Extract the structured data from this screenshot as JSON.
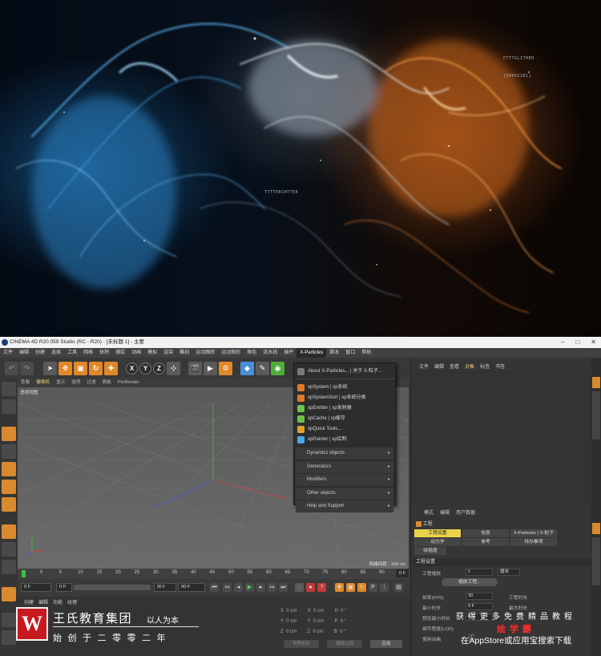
{
  "window": {
    "title": "CINEMA 4D R20.059 Studio (RC - R20) - [未标题 1] - 主要",
    "minimize": "–",
    "maximize": "□",
    "close": "✕"
  },
  "menubar": [
    "文件",
    "编辑",
    "创建",
    "选择",
    "工具",
    "网格",
    "体积",
    "捕捉",
    "动画",
    "模拟",
    "渲染",
    "雕刻",
    "运动跟踪",
    "运动图形",
    "角色",
    "流水线",
    "插件",
    "X-Particles",
    "脚本",
    "窗口",
    "帮助"
  ],
  "toolbar": {
    "axis_x": "X",
    "axis_y": "Y",
    "axis_z": "Z"
  },
  "viewport": {
    "menu": [
      "查看",
      "摄像机",
      "显示",
      "选项",
      "过滤",
      "面板",
      "ProRender"
    ],
    "label": "透视视图",
    "grid_spacing": "网格间距 : 100 cm"
  },
  "xparticles_menu": {
    "about": "About X-Particles... | 关于 X-粒子...",
    "items": [
      {
        "label": "xpSystem | xp系统",
        "icon_color": "#e07a2a"
      },
      {
        "label": "xpSystemSort | xp系统分类",
        "icon_color": "#e07a2a"
      },
      {
        "label": "xpEmitter | xp发射器",
        "icon_color": "#6fc24a"
      },
      {
        "label": "xpCache | xp缓存",
        "icon_color": "#6fc24a"
      },
      {
        "label": "xpQuick Tools...",
        "icon_color": "#e0a22a"
      },
      {
        "label": "xpPainter | xp绘制",
        "icon_color": "#4aa8e0"
      }
    ],
    "submenus": [
      "Dynamics objects",
      "Generators",
      "Modifiers",
      "Other objects",
      "Help and Support"
    ]
  },
  "timeline": {
    "ticks": [
      "0",
      "5",
      "10",
      "15",
      "20",
      "25",
      "30",
      "35",
      "40",
      "45",
      "50",
      "55",
      "60",
      "65",
      "70",
      "75",
      "80",
      "85",
      "90"
    ],
    "end_field": "0 F",
    "start_field": "0 F",
    "frame_field": "0 F",
    "range_end": "90 F",
    "range_end2": "90 F"
  },
  "material_menu": [
    "创建",
    "编辑",
    "功能",
    "纹理"
  ],
  "coords": {
    "x_label": "X",
    "y_label": "Y",
    "z_label": "Z",
    "val": "0 cm",
    "h_label": "H",
    "p_label": "P",
    "b_label": "B",
    "rot": "0 °",
    "world_btn": "世界坐标",
    "scale_btn": "缩放比例",
    "apply_btn": "应用"
  },
  "object_manager": {
    "menu": [
      "文件",
      "编辑",
      "查看",
      "对象",
      "标签",
      "书签"
    ]
  },
  "attributes": {
    "menu": [
      "模式",
      "编辑",
      "用户数据"
    ],
    "title": "工程",
    "tabs_row1": [
      "工程设置",
      "信息",
      "X-Particles | X-粒子"
    ],
    "tabs_row2": [
      "动力学",
      "参考",
      "待办事项"
    ],
    "tabs_row3": [
      "帧插值"
    ],
    "section": "工程设置",
    "scale_label": "工程缩放",
    "scale_value": "1",
    "scale_unit": "厘米",
    "scale_btn": "缩放工程...",
    "fps_label": "帧率(FPS)",
    "fps_value": "30",
    "time_label": "工程时长",
    "min_label": "最小时长",
    "min_value": "0 F",
    "max_label": "最大时长",
    "preview_min_label": "预览最小时长",
    "preview_min_value": "0 F",
    "lod_label": "细节程度(LOD)",
    "anim_label": "使用动画"
  },
  "hero_hud": {
    "tr1": "PTTTGLITHER",
    "tr2": "[SHP02381]",
    "mid1": "TTTTERSHTTER"
  },
  "brand": {
    "logo_letter": "W",
    "name": "王氏教育集团",
    "motto": "以人为本",
    "since": "始创于二零零二年"
  },
  "promo": {
    "line1": "获得更多免费精品教程",
    "line2": "绘学霸",
    "line3": "在AppStore或应用宝搜索下载"
  },
  "colors": {
    "accent_yellow": "#e9d24a",
    "accent_orange": "#e0882a",
    "logo_red": "#c61a20",
    "promo_red": "#ff2b2b"
  }
}
